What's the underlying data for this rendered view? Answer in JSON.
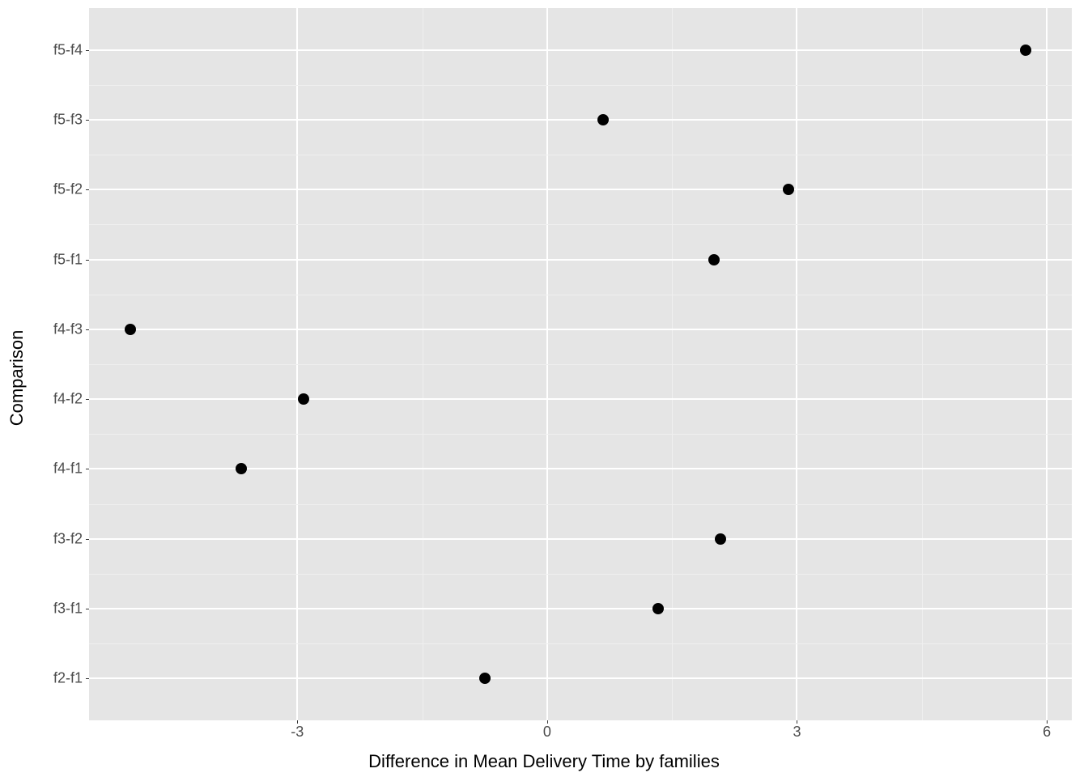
{
  "chart_data": {
    "type": "scatter",
    "xlabel": "Difference in Mean Delivery Time by families",
    "ylabel": "Comparison",
    "xlim": [
      -5.5,
      6.3
    ],
    "x_ticks": [
      -3,
      0,
      3,
      6
    ],
    "categories": [
      "f2-f1",
      "f3-f1",
      "f3-f2",
      "f4-f1",
      "f4-f2",
      "f4-f3",
      "f5-f1",
      "f5-f2",
      "f5-f3",
      "f5-f4"
    ],
    "points": [
      {
        "y": "f2-f1",
        "x": -0.75
      },
      {
        "y": "f3-f1",
        "x": 1.33
      },
      {
        "y": "f3-f2",
        "x": 2.08
      },
      {
        "y": "f4-f1",
        "x": -3.67
      },
      {
        "y": "f4-f2",
        "x": -2.92
      },
      {
        "y": "f4-f3",
        "x": -5.0
      },
      {
        "y": "f5-f1",
        "x": 2.0
      },
      {
        "y": "f5-f2",
        "x": 2.9
      },
      {
        "y": "f5-f3",
        "x": 0.67
      },
      {
        "y": "f5-f4",
        "x": 5.75
      }
    ]
  }
}
